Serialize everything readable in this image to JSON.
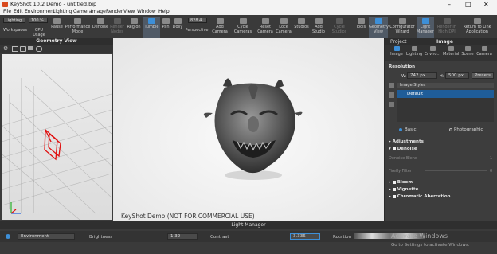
{
  "window": {
    "title": "KeyShot 10.2 Demo  -  untitled.bip"
  },
  "menu": [
    "File",
    "Edit",
    "Environment",
    "Lighting",
    "Camera",
    "Image",
    "Render",
    "View",
    "Window",
    "Help"
  ],
  "toolbar": {
    "lighting_preset": "Lighting",
    "cpu_percent": "100 %",
    "pixel_value": "828.4",
    "items": {
      "workspaces": "Workspaces",
      "cpu_usage": "CPU Usage",
      "pause": "Pause",
      "performance_mode": "Performance Mode",
      "denoise": "Denoise",
      "render_nodes": "Render Nodes",
      "region": "Region",
      "tumble": "Tumble",
      "pan": "Pan",
      "dolly": "Dolly",
      "perspective": "Perspective",
      "add_camera": "Add Camera",
      "cycle_cameras": "Cycle Cameras",
      "reset_camera": "Reset Camera",
      "lock_camera": "Lock Camera",
      "studios": "Studios",
      "add_studio": "Add Studio",
      "cycle_studios": "Cycle Studios",
      "tools": "Tools",
      "geometry_view": "Geometry View",
      "configurator_wizard": "Configurator Wizard",
      "light_manager": "Light Manager",
      "render_in_high_dpi": "Render in High DPI",
      "return_to_link": "Return to Link Application"
    }
  },
  "geometry_view": {
    "title": "Geometry View"
  },
  "viewport": {
    "watermark": "KeyShot Demo (NOT FOR COMMERCIAL USE)"
  },
  "right_panel": {
    "tabs": [
      "Project",
      "Image"
    ],
    "sub_tabs": [
      "Image",
      "Lighting",
      "Enviro...",
      "Material",
      "Scene",
      "Camera"
    ],
    "resolution_label": "Resolution",
    "width_label": "W:",
    "width_value": "742 px",
    "height_label": "H:",
    "height_value": "500 px",
    "presets_label": "Presets",
    "image_styles_label": "Image Styles",
    "style_default": "Default",
    "mode_basic": "Basic",
    "mode_photographic": "Photographic",
    "adjustments": "Adjustments",
    "denoise": "Denoise",
    "denoise_blend": "Denoise Blend",
    "denoise_blend_value": "1",
    "firefly_filter": "Firefly Filter",
    "firefly_value": "0",
    "bloom": "Bloom",
    "vignette": "Vignette",
    "chromatic_aberration": "Chromatic Aberration"
  },
  "light_manager": {
    "title": "Light Manager",
    "source": "Environment",
    "brightness_label": "Brightness",
    "brightness_value": "1.32",
    "contrast_label": "Contrast",
    "contrast_value": "3.336",
    "rotation_label": "Rotation"
  },
  "os_overlay": {
    "activate": "Activate Windows",
    "activate_sub": "Go to Settings to activate Windows."
  },
  "colors": {
    "accent": "#3d8fd8",
    "selection": "#1f5d99",
    "viewport_bg": "#f6f6f6",
    "panel_bg": "#3b3b3b"
  }
}
